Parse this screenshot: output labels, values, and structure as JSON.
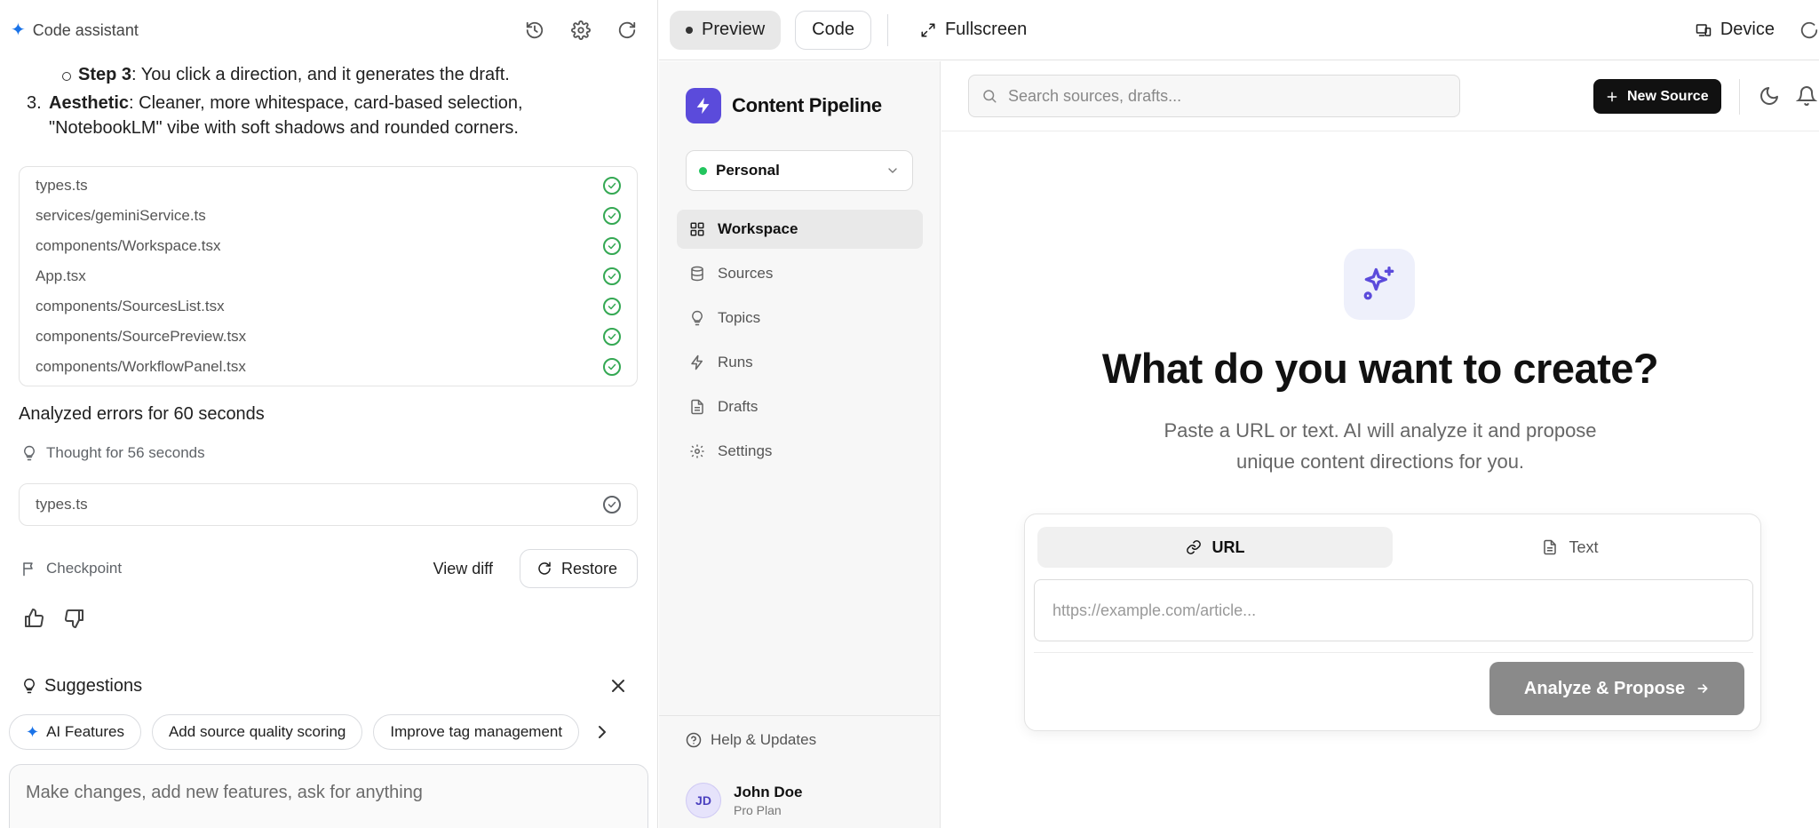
{
  "chat": {
    "title": "Code assistant",
    "message": {
      "step3_bold": "Step 3",
      "step3_text": ": You click a direction, and it generates the draft.",
      "item3_num": "3.",
      "item3_bold": "Aesthetic",
      "item3_text": ": Cleaner, more whitespace, card-based selection, \"NotebookLM\" vibe with soft shadows and rounded corners."
    },
    "files": [
      "types.ts",
      "services/geminiService.ts",
      "components/Workspace.tsx",
      "App.tsx",
      "components/SourcesList.tsx",
      "components/SourcePreview.tsx",
      "components/WorkflowPanel.tsx"
    ],
    "analyzed": "Analyzed errors for 60 seconds",
    "thought": "Thought for 56 seconds",
    "files2": [
      "types.ts"
    ],
    "checkpoint": "Checkpoint",
    "view_diff": "View diff",
    "restore": "Restore",
    "suggestions_title": "Suggestions",
    "chips": [
      "AI Features",
      "Add source quality scoring",
      "Improve tag management"
    ],
    "prompt_placeholder": "Make changes, add new features, ask for anything"
  },
  "toolbar": {
    "preview": "Preview",
    "code": "Code",
    "fullscreen": "Fullscreen",
    "device": "Device"
  },
  "app": {
    "name": "Content Pipeline",
    "workspace": "Personal",
    "nav": [
      "Workspace",
      "Sources",
      "Topics",
      "Runs",
      "Drafts",
      "Settings"
    ],
    "help": "Help & Updates",
    "user": {
      "initials": "JD",
      "name": "John Doe",
      "plan": "Pro Plan"
    },
    "search_placeholder": "Search sources, drafts...",
    "new_source": "New Source",
    "hero_title": "What do you want to create?",
    "hero_sub": "Paste a URL or text. AI will analyze it and propose unique content directions for you.",
    "tab_url": "URL",
    "tab_text": "Text",
    "url_placeholder": "https://example.com/article...",
    "analyze": "Analyze & Propose"
  },
  "colors": {
    "accent": "#5b4bdb",
    "check_green": "#34a853",
    "status_dot": "#22c55e"
  }
}
